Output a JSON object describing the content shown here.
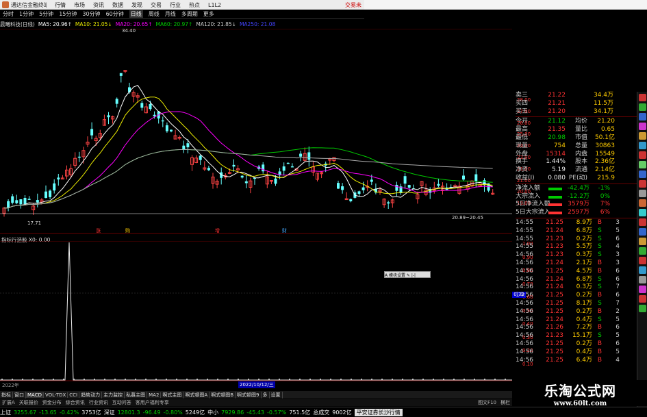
{
  "titlebar": {
    "app_name": "通达信金融终端",
    "menu": [
      "行情",
      "市场",
      "资讯",
      "数据",
      "发现",
      "交易",
      "行业",
      "热点",
      "L1L2"
    ],
    "trade_link": "交易未"
  },
  "periods": [
    "分时",
    "1分钟",
    "5分钟",
    "15分钟",
    "30分钟",
    "60分钟",
    "日线",
    "周线",
    "月线",
    "多周期",
    "更多"
  ],
  "active_period": "日线",
  "ma_legend": [
    {
      "text": "晨曦科技(日线)",
      "color": "#ddd"
    },
    {
      "text": "MA5: 20.96↑",
      "color": "#fff"
    },
    {
      "text": "MA10: 21.05↓",
      "color": "#ee0"
    },
    {
      "text": "MA20: 20.65↑",
      "color": "#f0f"
    },
    {
      "text": "MA60: 20.97↑",
      "color": "#0c0"
    },
    {
      "text": "MA120: 21.85↓",
      "color": "#ccc"
    },
    {
      "text": "MA250: 21.08",
      "color": "#44f"
    }
  ],
  "kline": {
    "high_label": "34.40",
    "low_label": "17.71",
    "range_label": "20.89~20.45",
    "markers": [
      {
        "text": "涨",
        "color": "#f33"
      },
      {
        "text": "购",
        "color": "#fc0"
      },
      {
        "text": "增",
        "color": "#f33"
      },
      {
        "text": "财",
        "color": "#4af"
      }
    ]
  },
  "price_scale": [
    "28.00",
    "27.00",
    "26.00",
    "25.00",
    "24.00",
    "23.00",
    "22.00",
    "21.00",
    "20.00",
    "19.00"
  ],
  "sub_indicator": {
    "title": "指标行选股 X0: 0.00",
    "scale": [
      "1.00",
      "0.90",
      "0.80",
      "0.70",
      "0.60",
      "0.50",
      "0.40",
      "0.30",
      "0.20",
      "0.10"
    ],
    "current_value": "0.73"
  },
  "date_bar": {
    "left": "2022年",
    "mid": "2022/10/12/三"
  },
  "tooltip": "A 模块设置 ✎ |-|",
  "asks": [
    {
      "label": "卖三",
      "price": "21.22",
      "vol": "34.4万"
    },
    {
      "label": "买四",
      "price": "21.21",
      "vol": "11.5万"
    },
    {
      "label": "买五",
      "price": "21.20",
      "vol": "34.1万"
    }
  ],
  "info": [
    {
      "l1": "今开",
      "v1": "21.12",
      "c1": "green",
      "l2": "均价",
      "v2": "21.20"
    },
    {
      "l1": "最高",
      "v1": "21.35",
      "c1": "red",
      "l2": "量比",
      "v2": "0.65"
    },
    {
      "l1": "最低",
      "v1": "20.98",
      "c1": "green",
      "l2": "市值",
      "v2": "50.1亿"
    },
    {
      "l1": "现量",
      "v1": "754",
      "c1": "yellow",
      "l2": "总量",
      "v2": "30863"
    },
    {
      "l1": "外盘",
      "v1": "15314",
      "c1": "red",
      "l2": "内盘",
      "v2": "15549"
    },
    {
      "l1": "换手",
      "v1": "1.44%",
      "c1": "white",
      "l2": "股本",
      "v2": "2.36亿"
    },
    {
      "l1": "净资",
      "v1": "5.19",
      "c1": "white",
      "l2": "流通",
      "v2": "2.14亿"
    },
    {
      "l1": "收益(I)",
      "v1": "0.080",
      "c1": "white",
      "l2": "PE(动)",
      "v2": "215.9"
    }
  ],
  "flows": [
    {
      "label": "净流入额",
      "bar": "#0c0",
      "v1": "-42.4万",
      "c1": "green",
      "v2": "-1%"
    },
    {
      "label": "大宗流入",
      "bar": "#0c0",
      "v1": "-12.2万",
      "c1": "green",
      "v2": "0%"
    },
    {
      "label": "5日净流入额",
      "bar": "#f33",
      "v1": "3579万",
      "c1": "red",
      "v2": "7%"
    },
    {
      "label": "5日大宗流入",
      "bar": "#f33",
      "v1": "2597万",
      "c1": "red",
      "v2": "6%"
    }
  ],
  "ticks": [
    {
      "t": "14:55",
      "p": "21.25",
      "v": "8.9万",
      "s": "B",
      "n": "3"
    },
    {
      "t": "14:55",
      "p": "21.24",
      "v": "6.8万",
      "s": "S",
      "n": "5"
    },
    {
      "t": "14:55",
      "p": "21.23",
      "v": "0.2万",
      "s": "S",
      "n": "6"
    },
    {
      "t": "14:55",
      "p": "21.23",
      "v": "5.5万",
      "s": "S",
      "n": "4"
    },
    {
      "t": "14:56",
      "p": "21.23",
      "v": "0.3万",
      "s": "S",
      "n": "3"
    },
    {
      "t": "14:56",
      "p": "21.24",
      "v": "2.1万",
      "s": "B",
      "n": "3"
    },
    {
      "t": "14:56",
      "p": "21.25",
      "v": "4.5万",
      "s": "B",
      "n": "6"
    },
    {
      "t": "14:56",
      "p": "21.24",
      "v": "6.8万",
      "s": "S",
      "n": "6"
    },
    {
      "t": "14:56",
      "p": "21.24",
      "v": "0.3万",
      "s": "S",
      "n": "7"
    },
    {
      "t": "14:56",
      "p": "21.25",
      "v": "0.2万",
      "s": "B",
      "n": "6"
    },
    {
      "t": "14:56",
      "p": "21.25",
      "v": "8.1万",
      "s": "S",
      "n": "7"
    },
    {
      "t": "14:56",
      "p": "21.25",
      "v": "0.2万",
      "s": "B",
      "n": "2"
    },
    {
      "t": "14:56",
      "p": "21.24",
      "v": "0.4万",
      "s": "S",
      "n": "5"
    },
    {
      "t": "14:56",
      "p": "21.26",
      "v": "7.2万",
      "s": "B",
      "n": "6"
    },
    {
      "t": "14:56",
      "p": "21.23",
      "v": "15.1万",
      "s": "S",
      "n": "5"
    },
    {
      "t": "14:56",
      "p": "21.25",
      "v": "0.2万",
      "s": "B",
      "n": "6"
    },
    {
      "t": "14:56",
      "p": "21.25",
      "v": "0.4万",
      "s": "B",
      "n": "5"
    },
    {
      "t": "14:56",
      "p": "21.25",
      "v": "6.4万",
      "s": "B",
      "n": "4"
    }
  ],
  "indicator_tabs": [
    "指标",
    "窗口",
    "MACD",
    "VOL-TDX",
    "CCI",
    "趋势动力",
    "主力监控",
    "私募主图",
    "MA2",
    "啊式主图",
    "啊式顿图A",
    "啊式顿图B",
    "啊式顿图9",
    "多",
    "设置"
  ],
  "active_indicator_tab": "MACD",
  "toolbar_tabs": [
    "扩展A",
    "关联报价",
    "资金分布",
    "综合资讯",
    "行业资讯",
    "互动问答",
    "客用户福利专享"
  ],
  "status": {
    "items": [
      {
        "label": "上证",
        "val": "3255.67",
        "chg": "-13.65",
        "pct": "-0.42%",
        "amt": "3753亿"
      },
      {
        "label": "深证",
        "val": "12801.3",
        "chg": "-96.49",
        "pct": "-0.80%",
        "amt": "5249亿"
      },
      {
        "label": "中小",
        "val": "7929.86",
        "chg": "-45.43",
        "pct": "-0.57%",
        "amt": "751.5亿"
      }
    ],
    "total_label": "总成交",
    "total_val": "9002亿",
    "broker": "平安证券长沙行情"
  },
  "right_tabs": {
    "left": "图文F10",
    "right": "横栏"
  },
  "watermark": {
    "title": "乐淘公式网",
    "url": "www.60lt.com"
  }
}
